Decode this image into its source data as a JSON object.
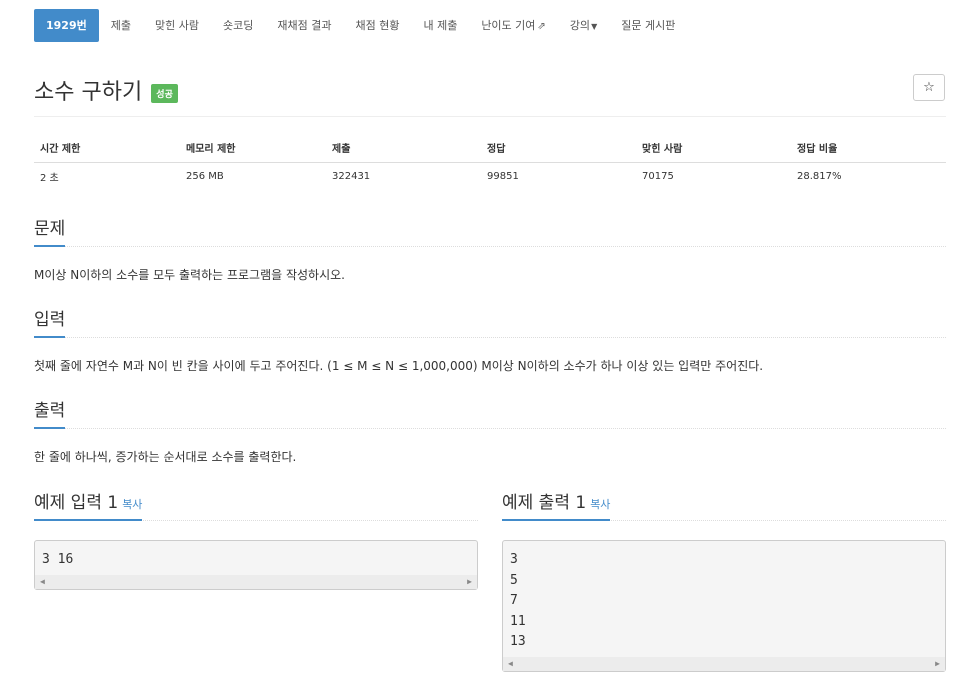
{
  "nav": {
    "tabs": [
      {
        "label": "1929번"
      },
      {
        "label": "제출"
      },
      {
        "label": "맞힌 사람"
      },
      {
        "label": "숏코딩"
      },
      {
        "label": "재채점 결과"
      },
      {
        "label": "채점 현황"
      },
      {
        "label": "내 제출"
      },
      {
        "label": "난이도 기여"
      },
      {
        "label": "강의"
      },
      {
        "label": "질문 게시판"
      }
    ]
  },
  "problem": {
    "title": "소수 구하기",
    "badge": "성공",
    "star_icon": "☆"
  },
  "info_table": {
    "headers": [
      "시간 제한",
      "메모리 제한",
      "제출",
      "정답",
      "맞힌 사람",
      "정답 비율"
    ],
    "values": [
      "2 초",
      "256 MB",
      "322431",
      "99851",
      "70175",
      "28.817%"
    ]
  },
  "sections": {
    "description": {
      "heading": "문제",
      "text": "M이상 N이하의 소수를 모두 출력하는 프로그램을 작성하시오."
    },
    "input": {
      "heading": "입력",
      "text": "첫째 줄에 자연수 M과 N이 빈 칸을 사이에 두고 주어진다. (1 ≤ M ≤ N ≤ 1,000,000) M이상 N이하의 소수가 하나 이상 있는 입력만 주어진다."
    },
    "output": {
      "heading": "출력",
      "text": "한 줄에 하나씩, 증가하는 순서대로 소수를 출력한다."
    }
  },
  "samples": {
    "input": {
      "heading": "예제 입력 1",
      "copy_label": "복사",
      "lines": [
        "3 16"
      ]
    },
    "output": {
      "heading": "예제 출력 1",
      "copy_label": "복사",
      "lines": [
        "3",
        "5",
        "7",
        "11",
        "13"
      ]
    }
  },
  "colors": {
    "accent": "#428bca",
    "success": "#5cb85c"
  }
}
